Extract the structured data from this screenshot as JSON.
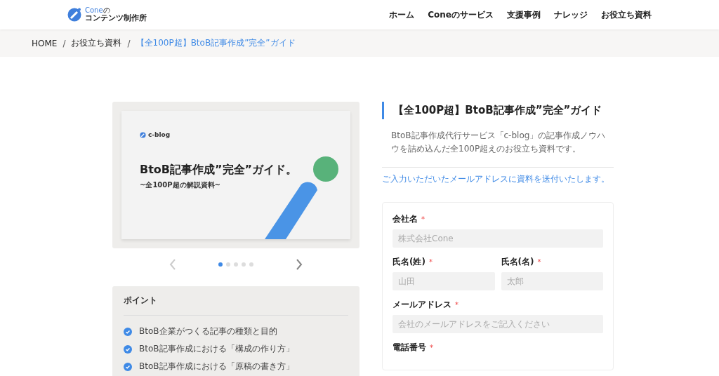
{
  "header": {
    "logo_top": "Cone",
    "logo_no": "の",
    "logo_bottom": "コンテンツ制作所",
    "nav": [
      "ホーム",
      "Coneのサービス",
      "支援事例",
      "ナレッジ",
      "お役立ち資料"
    ]
  },
  "breadcrumb_separator": "/",
  "breadcrumb": [
    {
      "label": "HOME",
      "current": false
    },
    {
      "label": "お役立ち資料",
      "current": false
    },
    {
      "label": "【全100P超】BtoB記事作成”完全”ガイド",
      "current": true
    }
  ],
  "slide": {
    "brand": "c-blog",
    "title": "BtoB記事作成”完全”ガイド。",
    "subtitle": "~全100P超の解説資料~"
  },
  "carousel": {
    "dots": [
      {
        "selected": true
      },
      {
        "selected": false
      },
      {
        "selected": false
      },
      {
        "selected": false
      },
      {
        "selected": false
      }
    ]
  },
  "points": {
    "title": "ポイント",
    "items": [
      "BtoB企業がつくる記事の種類と目的",
      "BtoB記事作成における「構成の作り方」",
      "BtoB記事作成における「原稿の書き方」"
    ]
  },
  "title": "【全100P超】BtoB記事作成”完全”ガイド",
  "description": "BtoB記事作成代行サービス「c-blog」の記事作成ノウハウを詰め込んだ全100P超えのお役立ち資料です。",
  "notice": "ご入力いただいたメールアドレスに資料を送付いたします。",
  "form": {
    "required_mark": "*",
    "rows": [
      [
        {
          "label": "会社名",
          "required": true,
          "placeholder": "株式会社Cone"
        }
      ],
      [
        {
          "label": "氏名(姓)",
          "required": true,
          "placeholder": "山田"
        },
        {
          "label": "氏名(名)",
          "required": true,
          "placeholder": "太郎"
        }
      ],
      [
        {
          "label": "メールアドレス",
          "required": true,
          "placeholder": "会社のメールアドレスをご記入ください"
        }
      ],
      [
        {
          "label": "電話番号",
          "required": true
        }
      ]
    ]
  }
}
